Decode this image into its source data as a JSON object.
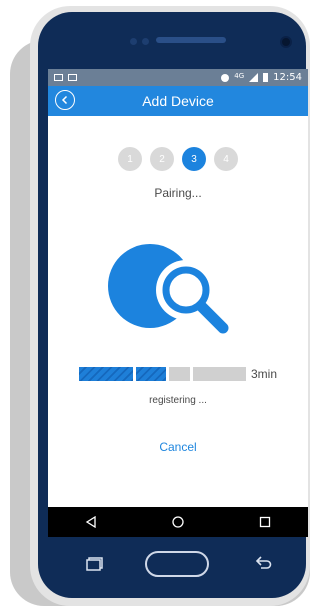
{
  "status_bar": {
    "network": "4G",
    "time": "12:54",
    "icons": [
      "message-icon",
      "image-icon",
      "sync-icon",
      "signal-icon",
      "battery-icon"
    ]
  },
  "header": {
    "title": "Add Device",
    "back_icon": "back-circle-icon"
  },
  "steps": [
    {
      "label": "1",
      "active": false
    },
    {
      "label": "2",
      "active": false
    },
    {
      "label": "3",
      "active": true
    },
    {
      "label": "4",
      "active": false
    }
  ],
  "pairing_text": "Pairing...",
  "illustration": {
    "icon": "search-icon"
  },
  "progress": {
    "segments_filled": 2,
    "segments_total": 4,
    "label": "3min"
  },
  "status_message": "registering ...",
  "cancel_label": "Cancel",
  "nav_bar": {
    "icons": [
      "nav-back-icon",
      "nav-home-icon",
      "nav-recents-icon"
    ]
  },
  "hardware_keys": {
    "icons": [
      "recent-apps-icon",
      "home-key",
      "back-key-icon"
    ]
  },
  "colors": {
    "accent": "#2287de",
    "active_step": "#1c83de",
    "phone_body": "#0f2c57",
    "progress_fill": "#1e7fd8"
  }
}
